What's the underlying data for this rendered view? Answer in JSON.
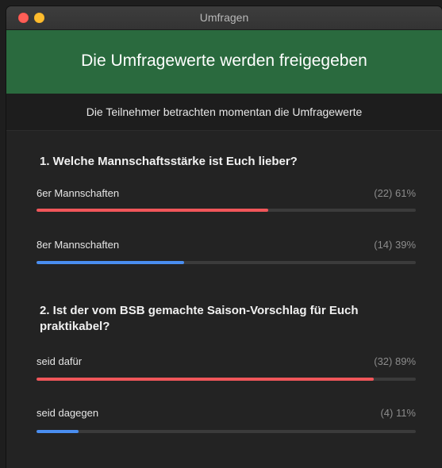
{
  "window": {
    "title": "Umfragen"
  },
  "banner": {
    "title": "Die Umfragewerte werden freigegeben"
  },
  "subheader": {
    "text": "Die Teilnehmer betrachten momentan die Umfragewerte"
  },
  "colors": {
    "banner_bg": "#2a6a3e",
    "bar_red": "#f0565a",
    "bar_blue": "#4a8ef0",
    "bar_track": "#3b3b3b"
  },
  "questions": [
    {
      "title": "1. Welche Mannschaftsstärke ist Euch lieber?",
      "options": [
        {
          "label": "6er Mannschaften",
          "result": "(22) 61%",
          "fraction": 0.61,
          "color": "red"
        },
        {
          "label": "8er Mannschaften",
          "result": "(14) 39%",
          "fraction": 0.39,
          "color": "blue"
        }
      ]
    },
    {
      "title": "2. Ist der vom BSB gemachte Saison-Vorschlag für Euch praktikabel?",
      "options": [
        {
          "label": "seid dafür",
          "result": "(32) 89%",
          "fraction": 0.89,
          "color": "red"
        },
        {
          "label": "seid dagegen",
          "result": "(4) 11%",
          "fraction": 0.11,
          "color": "blue"
        }
      ]
    }
  ]
}
